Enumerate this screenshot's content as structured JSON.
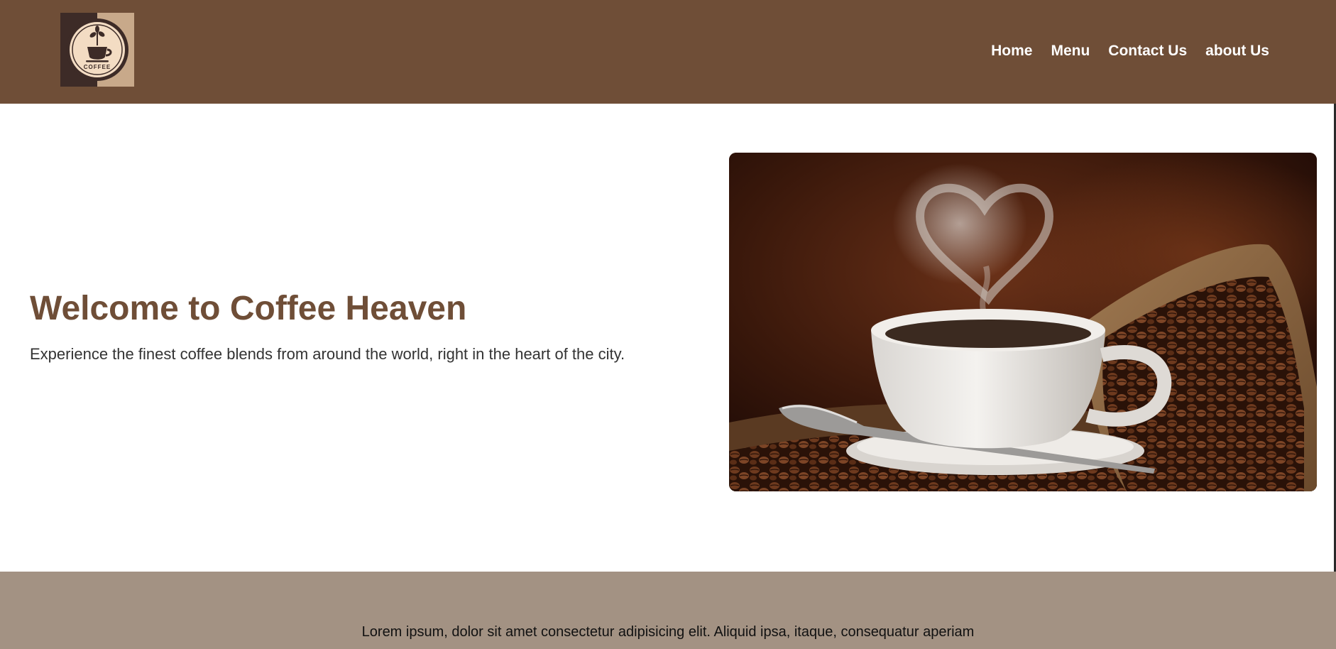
{
  "header": {
    "logo_text": "COFFEE",
    "nav": [
      {
        "label": "Home"
      },
      {
        "label": "Menu"
      },
      {
        "label": "Contact Us"
      },
      {
        "label": "about Us"
      }
    ]
  },
  "hero": {
    "title": "Welcome to Coffee Heaven",
    "subtitle": "Experience the finest coffee blends from around the world, right in the heart of the city.",
    "image_alt": "Coffee cup with heart-shaped steam beside a burlap sack of coffee beans"
  },
  "footer": {
    "text": "Lorem ipsum, dolor sit amet consectetur adipisicing elit. Aliquid ipsa, itaque, consequatur aperiam"
  },
  "colors": {
    "brand_brown": "#6f4e37",
    "footer_band": "#a39283"
  }
}
